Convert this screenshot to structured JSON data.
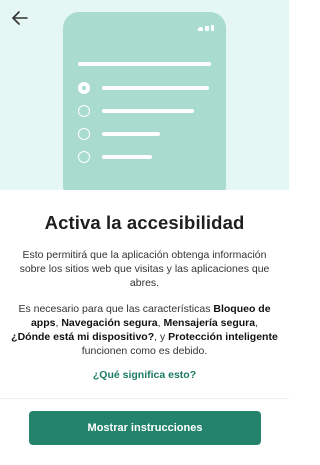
{
  "header": {
    "back_icon": "arrow-left-icon"
  },
  "illustration": {
    "options": [
      {
        "selected": true
      },
      {
        "selected": false
      },
      {
        "selected": false
      },
      {
        "selected": false
      }
    ]
  },
  "main": {
    "title": "Activa la accesibilidad",
    "paragraph1": "Esto permitirá que la aplicación obtenga información sobre los sitios web que visitas y las aplicaciones que abres.",
    "paragraph2": {
      "intro": "Es necesario para que las características ",
      "feature1": "Bloqueo de apps",
      "sep1": ", ",
      "feature2": "Navegación segura",
      "sep2": ", ",
      "feature3": "Mensajería segura",
      "sep3": ", ",
      "feature4": "¿Dónde está mi dispositivo?",
      "sep4": ", y ",
      "feature5": "Protección inteligente",
      "outro": " funcionen como es debido."
    },
    "link": "¿Qué significa esto?"
  },
  "footer": {
    "button_label": "Mostrar instrucciones"
  },
  "colors": {
    "accent": "#24836c",
    "hero_bg": "#e5f7f3",
    "phone": "#a9dccf",
    "link": "#1b7a63"
  }
}
